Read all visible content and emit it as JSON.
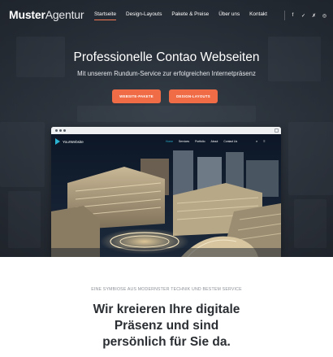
{
  "logo": {
    "bold": "Muster",
    "light": "Agentur"
  },
  "nav": {
    "items": [
      {
        "label": "Startseite",
        "active": true
      },
      {
        "label": "Design-Layouts",
        "active": false
      },
      {
        "label": "Pakete & Preise",
        "active": false
      },
      {
        "label": "Über uns",
        "active": false
      },
      {
        "label": "Kontakt",
        "active": false
      }
    ],
    "social": [
      {
        "icon": "facebook-icon",
        "glyph": "f"
      },
      {
        "icon": "twitter-icon",
        "glyph": "✓"
      },
      {
        "icon": "xing-icon",
        "glyph": "✗"
      },
      {
        "icon": "instagram-icon",
        "glyph": "◎"
      }
    ]
  },
  "hero": {
    "title": "Professionelle Contao Webseiten",
    "subtitle": "Mit unserem Rundum-Service zur erfolgreichen Internetpräsenz",
    "button1": "WEBSITE-PAKETE",
    "button2": "DESIGN-LAYOUTS"
  },
  "mockup": {
    "site_name": "YourWebsite",
    "menu": [
      {
        "label": "Home",
        "active": true
      },
      {
        "label": "Services",
        "active": false
      },
      {
        "label": "Portfolio",
        "active": false
      },
      {
        "label": "About",
        "active": false
      },
      {
        "label": "Contact Us",
        "active": false
      }
    ],
    "icons": {
      "search": "⌕",
      "menu": "≡"
    }
  },
  "content": {
    "kicker": "EINE SYMBIOSE AUS MODERNSTER TECHNIK UND BESTEM SERVICE",
    "headline_lines": [
      "Wir kreieren Ihre digitale",
      "Präsenz und sind",
      "persönlich für Sie da."
    ]
  },
  "colors": {
    "accent": "#ef6c46",
    "mockup_accent": "#2bb3d3",
    "hero_bg": "#2c333c"
  }
}
